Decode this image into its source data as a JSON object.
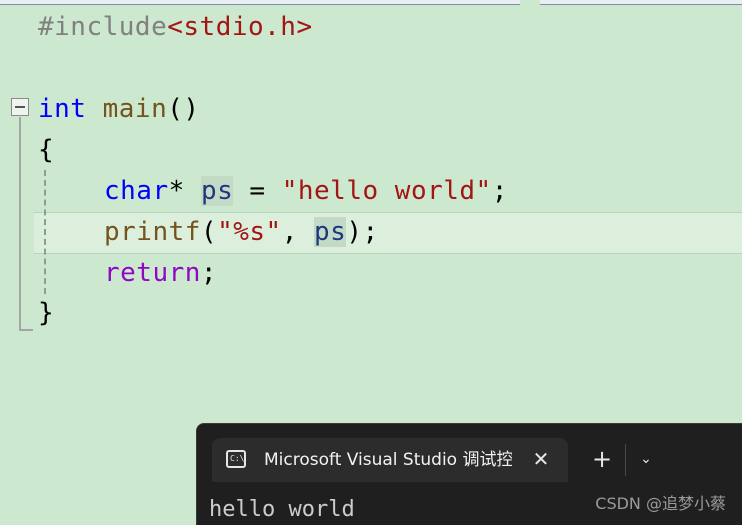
{
  "editor": {
    "lines": {
      "l1": {
        "hash_include": "#include",
        "header": "<stdio.h>"
      },
      "l3": {
        "type": "int",
        "name": "main",
        "parens": "()"
      },
      "l4": {
        "brace_open": "{"
      },
      "l5": {
        "type": "char",
        "star": "*",
        "var": "ps",
        "eq": "=",
        "value": "\"hello world\"",
        "semi": ";"
      },
      "l6": {
        "fn": "printf",
        "open": "(",
        "fmt": "\"%s\"",
        "comma": ",",
        "var": "ps",
        "close": ");"
      },
      "l7": {
        "keyword": "return",
        "semi": ";"
      },
      "l8": {
        "brace_close": "}"
      }
    },
    "colors": {
      "background": "#cce8cf",
      "keyword_blue": "#0000ff",
      "keyword_purple": "#8f08c4",
      "function": "#74531f",
      "string": "#a31515",
      "variable": "#1f377f"
    }
  },
  "terminal": {
    "icon_text": "C:\\",
    "tab_title": "Microsoft Visual Studio 调试控制台",
    "close_glyph": "✕",
    "new_tab_glyph": "+",
    "dropdown_glyph": "⌄",
    "output": "hello world"
  },
  "watermark": "CSDN @追梦小蔡"
}
